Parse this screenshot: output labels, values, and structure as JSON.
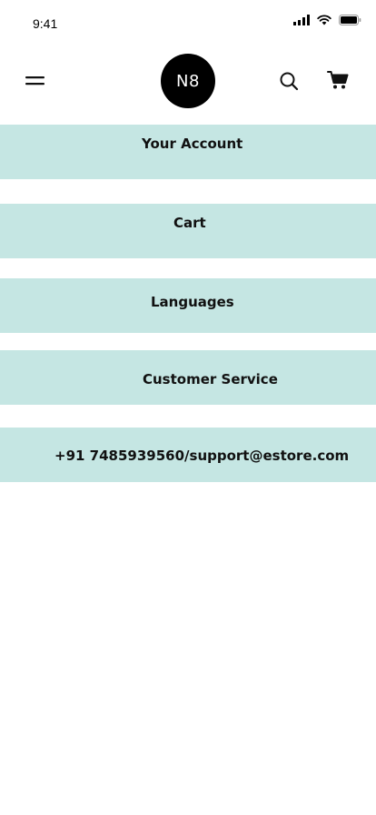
{
  "status_bar": {
    "time": "9:41"
  },
  "header": {
    "logo_text": "N8",
    "menu_icon": "hamburger-icon",
    "search_icon": "search-icon",
    "cart_icon": "cart-icon"
  },
  "menu": {
    "items": [
      {
        "label": "Your Account"
      },
      {
        "label": "Cart"
      },
      {
        "label": "Languages"
      },
      {
        "label": "Customer Service"
      },
      {
        "label": "+91 7485939560/support@estore.com"
      }
    ]
  },
  "colors": {
    "menu_item_bg": "#c5e6e3",
    "logo_bg": "#000000",
    "text": "#111111"
  }
}
